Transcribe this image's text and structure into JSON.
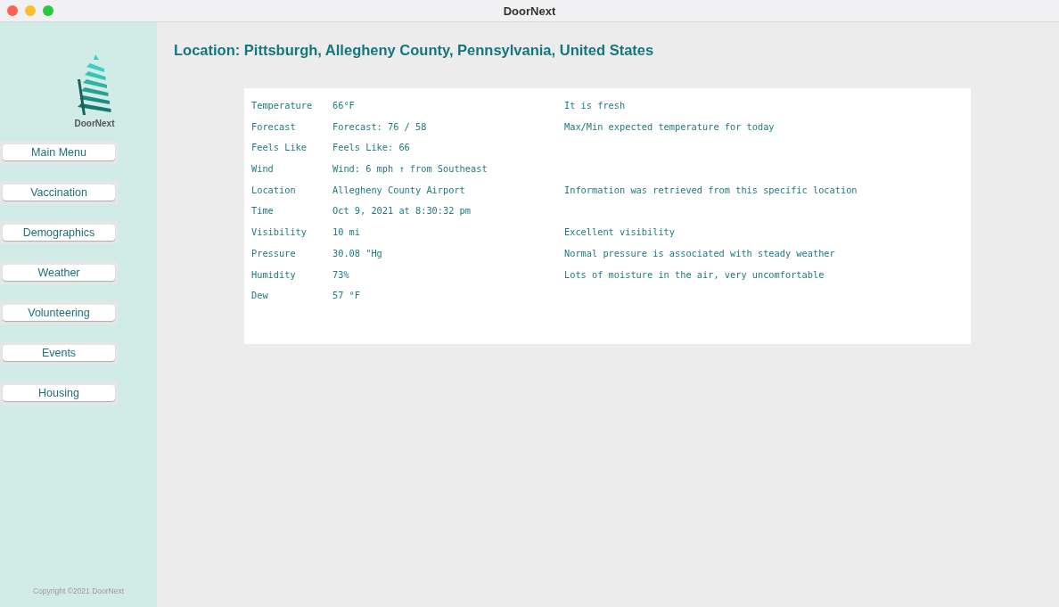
{
  "window": {
    "title": "DoorNext"
  },
  "sidebar": {
    "logo_text": "DoorNext",
    "items": [
      {
        "label": "Main Menu"
      },
      {
        "label": "Vaccination"
      },
      {
        "label": "Demographics"
      },
      {
        "label": "Weather"
      },
      {
        "label": "Volunteering"
      },
      {
        "label": "Events"
      },
      {
        "label": "Housing"
      }
    ],
    "copyright": "Copyright ©2021 DoorNext"
  },
  "heading": "Location: Pittsburgh, Allegheny County, Pennsylvania, United States",
  "rows": [
    {
      "label": "Temperature",
      "value": "66°F",
      "note": "It is fresh"
    },
    {
      "label": "Forecast",
      "value": "Forecast: 76 / 58",
      "note": "Max/Min expected temperature for today"
    },
    {
      "label": "Feels Like",
      "value": "Feels Like: 66"
    },
    {
      "label": "Wind",
      "value": "Wind: 6 mph ↑ from Southeast"
    },
    {
      "label": "Location",
      "value": "Allegheny County Airport",
      "note": "Information was retrieved from this specific location"
    },
    {
      "label": "Time",
      "value": "Oct 9, 2021 at 8:30:32 pm"
    },
    {
      "label": "Visibility",
      "value": "10 mi",
      "note": "Excellent visibility"
    },
    {
      "label": "Pressure",
      "value": "30.08 \"Hg",
      "note": "Normal pressure is associated with steady weather"
    },
    {
      "label": "Humidity",
      "value": "73%",
      "note": "Lots of moisture in the air, very uncomfortable"
    },
    {
      "label": "Dew",
      "value": "57 °F"
    }
  ]
}
